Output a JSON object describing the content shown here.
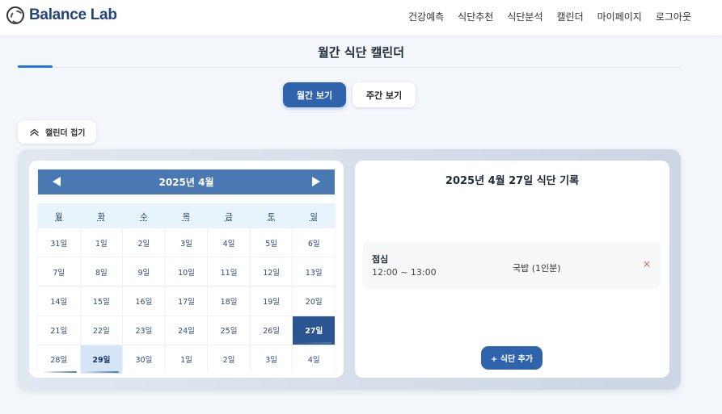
{
  "brand": {
    "name": "Balance Lab",
    "logo_icon": "leaf-circle-icon"
  },
  "nav": [
    "건강예측",
    "식단추천",
    "식단분석",
    "캘린더",
    "마이페이지",
    "로그아웃"
  ],
  "page": {
    "title": "월간 식단 캘린더"
  },
  "view_toggle": {
    "monthly": "월간 보기",
    "weekly": "주간 보기",
    "active": "monthly"
  },
  "collapse": {
    "label": "캘린더 접기",
    "icon": "chevron-up-icon"
  },
  "calendar": {
    "month_label": "2025년 4월",
    "weekdays": [
      "월",
      "화",
      "수",
      "목",
      "금",
      "토",
      "일"
    ],
    "days": [
      "31일",
      "1일",
      "2일",
      "3일",
      "4일",
      "5일",
      "6일",
      "7일",
      "8일",
      "9일",
      "10일",
      "11일",
      "12일",
      "13일",
      "14일",
      "15일",
      "16일",
      "17일",
      "18일",
      "19일",
      "20일",
      "21일",
      "22일",
      "23일",
      "24일",
      "25일",
      "26일",
      "27일",
      "28일",
      "29일",
      "30일",
      "1일",
      "2일",
      "3일",
      "4일"
    ],
    "selected": "27일",
    "today": "29일",
    "accent_color": "#4a78b3",
    "selected_color": "#2b5590"
  },
  "record": {
    "title": "2025년 4월 27일 식단 기록",
    "meals": [
      {
        "type": "점심",
        "time": "12:00 ~ 13:00",
        "food": "국밥 (1인분)",
        "delete": "×"
      }
    ],
    "add_label": "+ 식단 추가"
  }
}
